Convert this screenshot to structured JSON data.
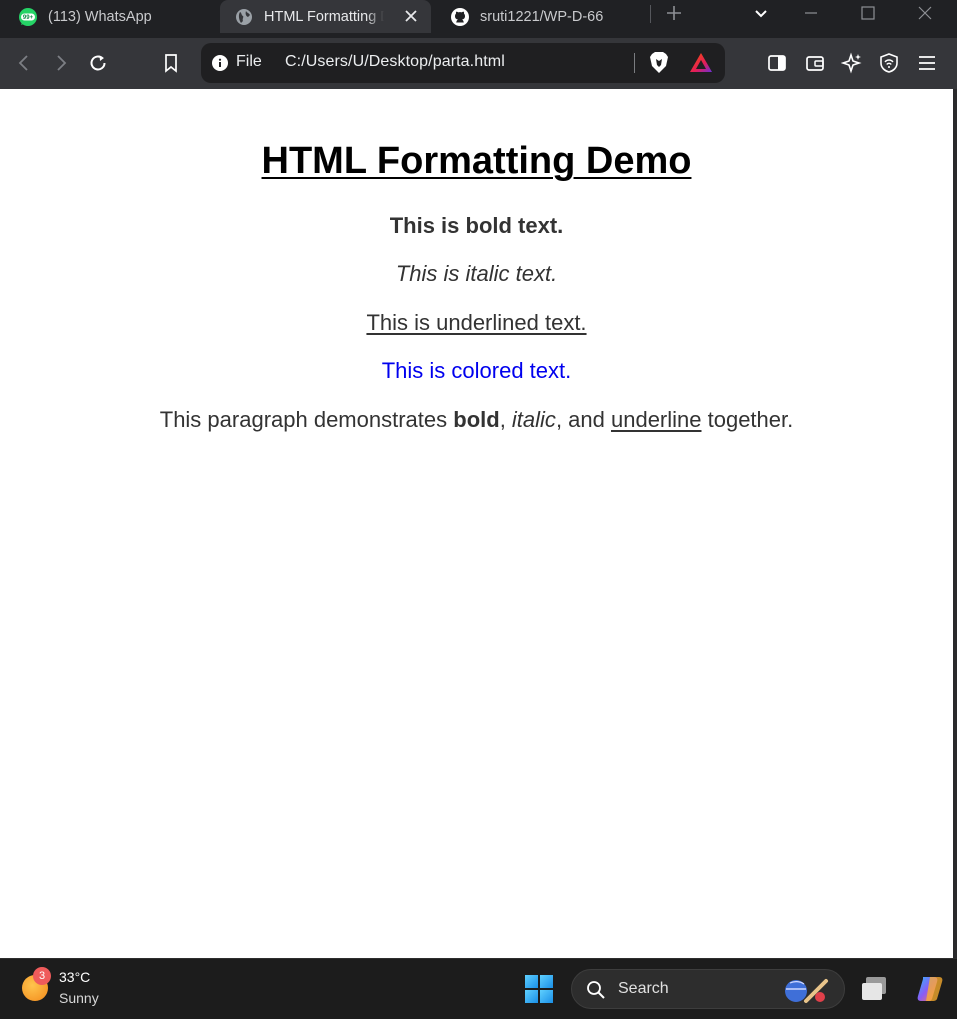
{
  "browser": {
    "tabs": [
      {
        "title": "(113) WhatsApp",
        "badge": "99+",
        "active": false
      },
      {
        "title": "HTML Formatting Demo",
        "active": true
      },
      {
        "title": "sruti1221/WP-D-66",
        "active": false
      }
    ],
    "address_bar": {
      "scheme_label": "File",
      "url": "C:/Users/U/Desktop/parta.html"
    }
  },
  "page": {
    "heading": "HTML Formatting Demo",
    "bold_line": "This is bold text.",
    "italic_line": "This is italic text.",
    "underline_line": "This is underlined text.",
    "colored_line": "This is colored text.",
    "colored_line_color": "#0000ee",
    "mixed": {
      "prefix": "This paragraph demonstrates ",
      "bold": "bold",
      "sep1": ", ",
      "italic": "italic",
      "sep2": ", and ",
      "underline": "underline",
      "suffix": " together."
    }
  },
  "taskbar": {
    "weather": {
      "badge": "3",
      "temperature": "33°C",
      "condition": "Sunny"
    },
    "search_label": "Search"
  }
}
